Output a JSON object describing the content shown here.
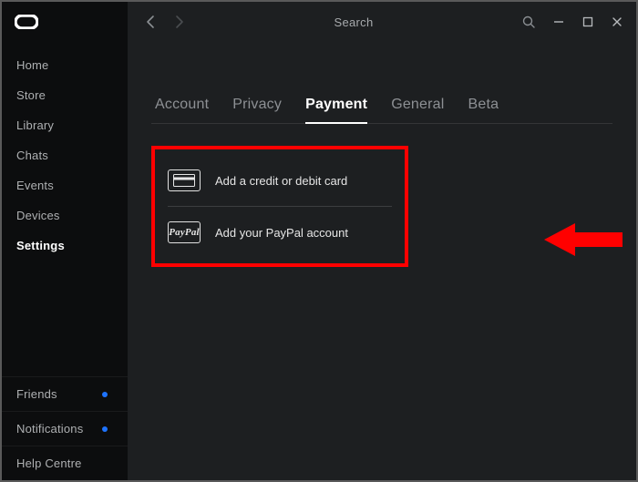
{
  "sidebar": {
    "items": [
      {
        "label": "Home"
      },
      {
        "label": "Store"
      },
      {
        "label": "Library"
      },
      {
        "label": "Chats"
      },
      {
        "label": "Events"
      },
      {
        "label": "Devices"
      },
      {
        "label": "Settings"
      }
    ],
    "bottom": [
      {
        "label": "Friends",
        "badge": true
      },
      {
        "label": "Notifications",
        "badge": true
      },
      {
        "label": "Help Centre",
        "badge": false
      }
    ],
    "active_index": 6
  },
  "topbar": {
    "search_placeholder": "Search"
  },
  "tabs": {
    "items": [
      {
        "label": "Account"
      },
      {
        "label": "Privacy"
      },
      {
        "label": "Payment"
      },
      {
        "label": "General"
      },
      {
        "label": "Beta"
      }
    ],
    "active_index": 2
  },
  "payment_options": {
    "card_label": "Add a credit or debit card",
    "paypal_label": "Add your PayPal account",
    "paypal_brand": "PayPal"
  }
}
